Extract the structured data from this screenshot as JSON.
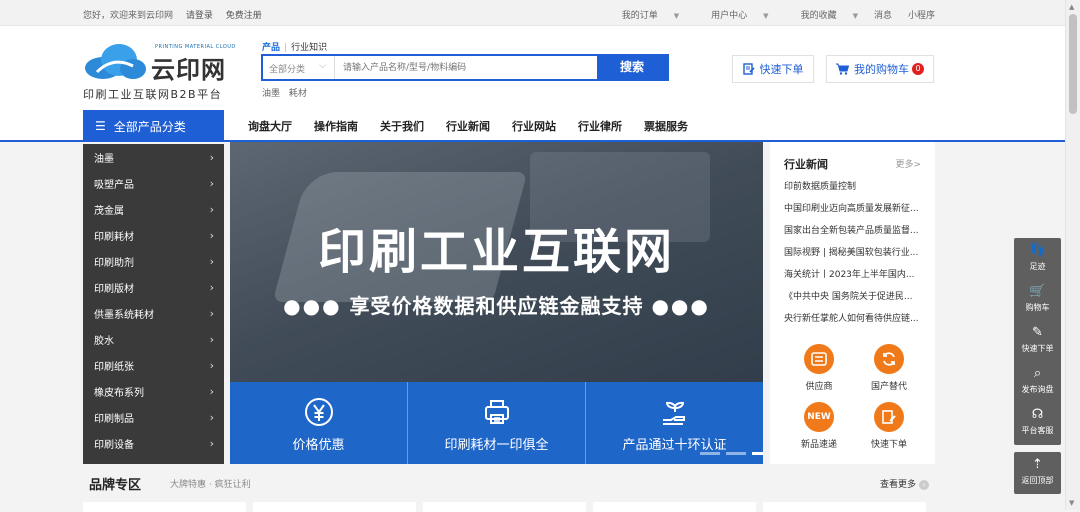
{
  "topbar": {
    "welcome": "您好，欢迎来到云印网",
    "login": "请登录",
    "register": "免费注册",
    "links": [
      "我的订单",
      "用户中心",
      "我的收藏",
      "消息",
      "小程序"
    ]
  },
  "logo": {
    "brand": "云印网",
    "tiny": "PRINTING MATERIAL CLOUD",
    "slogan": "印刷工业互联网B2B平台"
  },
  "search": {
    "tab_active": "产品",
    "tab_other": "行业知识",
    "category": "全部分类",
    "placeholder": "请输入产品名称/型号/物料编码",
    "button": "搜索",
    "hot": [
      "油墨",
      "耗材"
    ]
  },
  "header_actions": {
    "quick_order": "快速下单",
    "cart": "我的购物车",
    "cart_count": "0"
  },
  "nav": {
    "all_categories": "全部产品分类",
    "links": [
      "询盘大厅",
      "操作指南",
      "关于我们",
      "行业新闻",
      "行业网站",
      "行业律所",
      "票据服务"
    ]
  },
  "sidebar": {
    "items": [
      "油墨",
      "吸塑产品",
      "茂金属",
      "印刷耗材",
      "印刷助剂",
      "印刷版材",
      "供墨系统耗材",
      "胶水",
      "印刷纸张",
      "橡皮布系列",
      "印刷制品",
      "印刷设备"
    ]
  },
  "banner": {
    "title": "印刷工业互联网",
    "subtitle": "享受价格数据和供应链金融支持",
    "dots": "●●●",
    "features": [
      "价格优惠",
      "印刷耗材一印俱全",
      "产品通过十环认证"
    ]
  },
  "news": {
    "title": "行业新闻",
    "more": "更多>",
    "items": [
      "印前数据质量控制",
      "中国印刷业迈向高质量发展新征...",
      "国家出台全新包装产品质量监督...",
      "国际视野 | 揭秘美国软包装行业...",
      "海关统计丨2023年上半年国内...",
      "《中共中央 国务院关于促进民...",
      "央行新任掌舵人如何看待供应链..."
    ],
    "services": [
      "供应商",
      "国产替代",
      "新品速递",
      "快速下单"
    ],
    "new_badge": "NEW"
  },
  "float": {
    "items": [
      "足迹",
      "购物车",
      "快速下单",
      "发布询盘",
      "平台客服"
    ],
    "back_top": "返回顶部"
  },
  "brand_zone": {
    "title": "品牌专区",
    "subtitle": "大牌特惠 · 疯狂让利",
    "more": "查看更多"
  },
  "colors": {
    "primary": "#1f5fd6",
    "sidebar": "#3a3a3a",
    "orange": "#f07a1a",
    "feature_bar": "#1f66c9"
  }
}
